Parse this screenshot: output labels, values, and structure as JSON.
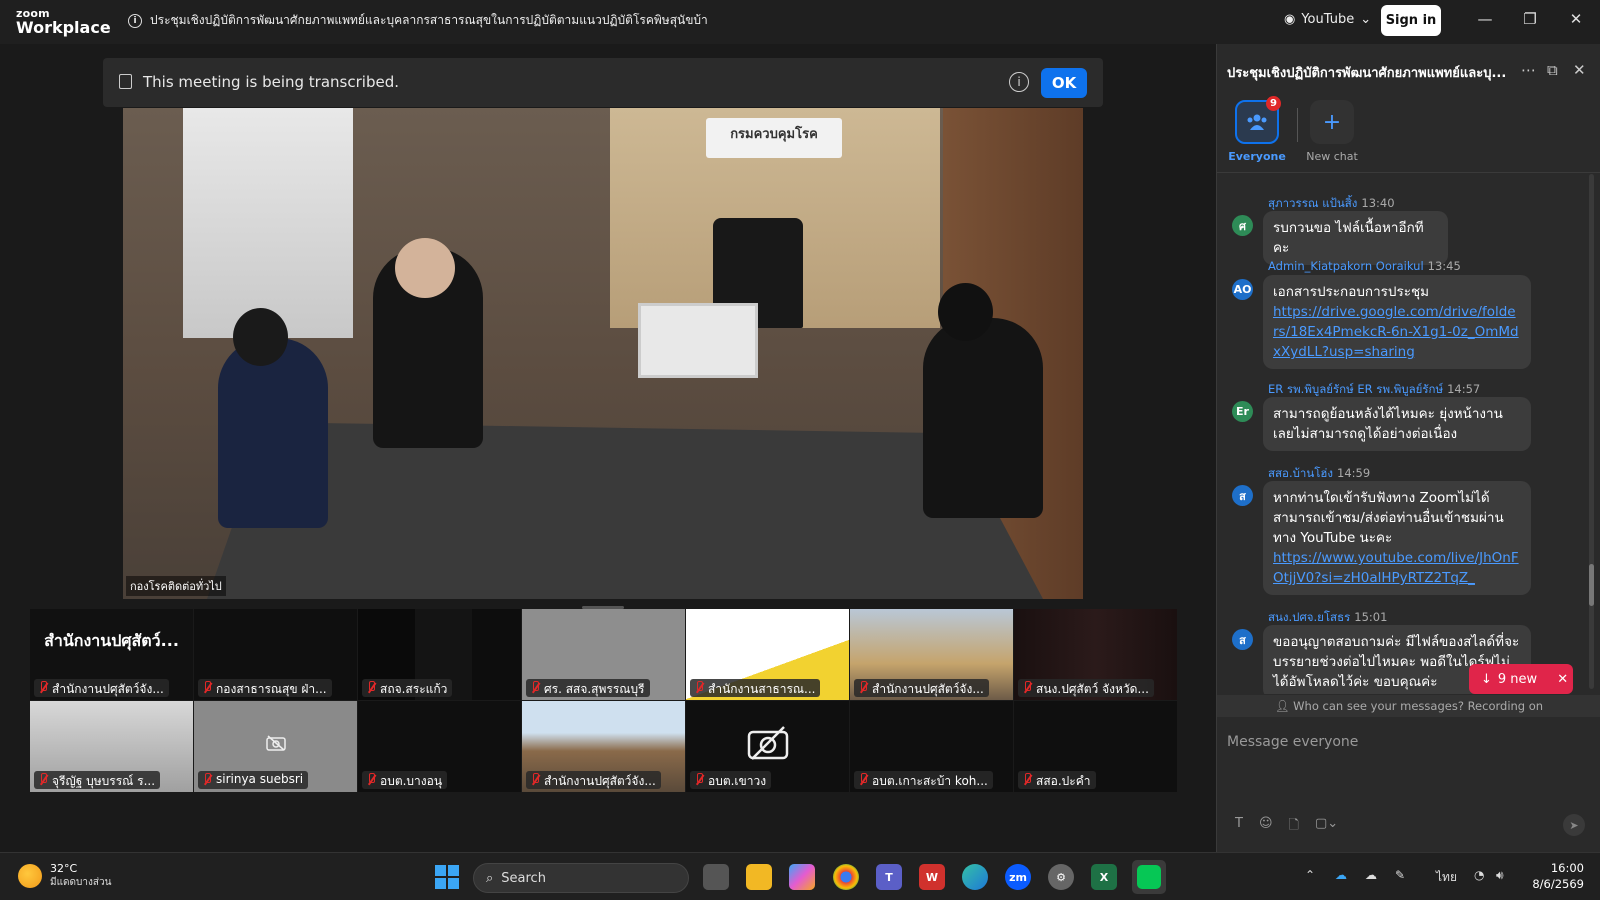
{
  "app": {
    "logo_top": "zoom",
    "logo_bottom": "Workplace",
    "meeting_title": "ประชุมเชิงปฏิบัติการพัฒนาศักยภาพแพทย์และบุคลากรสาธารณสุขในการปฏิบัติตามแนวปฏิบัติโรคพิษสุนัขบ้า"
  },
  "titlebar": {
    "youtube_label": "YouTube",
    "signin_label": "Sign in"
  },
  "banner": {
    "text": "This meeting is being transcribed.",
    "ok_label": "OK"
  },
  "main_video": {
    "sign_text": "กรมควบคุมโรค",
    "label": "กองโรคติดต่อทั่วไป"
  },
  "thumbnails": [
    {
      "name": "สำนักงานปศุสัตว์จัง...",
      "big": "สำนักงานปศุสัตว์..."
    },
    {
      "name": "กองสาธารณสุข ฝ่า..."
    },
    {
      "name": "สถจ.สระแก้ว"
    },
    {
      "name": "ศร. สสจ.สุพรรณบุรี"
    },
    {
      "name": "สำนักงานสาธารณ..."
    },
    {
      "name": "สำนักงานปศุสัตว์จัง..."
    },
    {
      "name": "สนง.ปศุสัตว์ จังหวัด..."
    },
    {
      "name": "จุรีญัฐ บุษบรรณ์ ร..."
    },
    {
      "name": "sirinya suebsri"
    },
    {
      "name": "อบต.บางอนุ"
    },
    {
      "name": "สำนักงานปศุสัตว์จัง..."
    },
    {
      "name": "อบต.เขาวง"
    },
    {
      "name": "อบต.เกาะสะบ้า koh..."
    },
    {
      "name": "สสอ.ปะคำ"
    }
  ],
  "chat": {
    "title": "ประชุมเชิงปฏิบัติการพัฒนาศักยภาพแพทย์และบุ...",
    "tabs": {
      "everyone": "Everyone",
      "new_chat": "New chat",
      "badge": "9"
    },
    "messages": [
      {
        "avatar": "ศ",
        "color": "#2e8b57",
        "sender": "สุภาวรรณ แป้นสิ้ง",
        "time": "13:40",
        "text": "รบกวนขอ ไฟล์เนื้อหาอีกทีคะ",
        "link": ""
      },
      {
        "avatar": "AO",
        "color": "#1e6fc9",
        "sender": "Admin_Kiatpakorn Ooraikul",
        "time": "13:45",
        "text": "เอกสารประกอบการประชุม",
        "link": "https://drive.google.com/drive/folders/18Ex4PmekcR-6n-X1g1-0z_OmMdxXydLL?usp=sharing"
      },
      {
        "avatar": "Er",
        "color": "#2e8b57",
        "sender": "ER รพ.พิบูลย์รักษ์ ER รพ.พิบูลย์รักษ์",
        "time": "14:57",
        "text": "สามารถดูย้อนหลังได้ไหมคะ ยุ่งหน้างาน เลยไม่สามารถดูได้อย่างต่อเนื่อง",
        "link": ""
      },
      {
        "avatar": "ส",
        "color": "#1e6fc9",
        "sender": "สสอ.บ้านโฮ่ง",
        "time": "14:59",
        "text": "หากท่านใดเข้ารับฟังทาง Zoomไม่ได้ สามารถเข้าชม/ส่งต่อท่านอื่นเข้าชมผ่านทาง YouTube นะคะ",
        "link": "https://www.youtube.com/live/JhOnFOtjjV0?si=zH0alHPyRTZ2TqZ_"
      },
      {
        "avatar": "ส",
        "color": "#1e6fc9",
        "sender": "สนง.ปศจ.ยโสธร",
        "time": "15:01",
        "text": "ขออนุญาตสอบถามค่ะ มีไฟล์ของสไลด์ที่จะบรรยายช่วงต่อไปไหมคะ พอดีในไดร์ฟไม่ได้อัพโหลดไว้ค่ะ ขอบคุณค่ะ",
        "link": ""
      }
    ],
    "new_messages": "9 new",
    "privacy": "Who can see your messages? Recording on",
    "compose_placeholder": "Message everyone"
  },
  "taskbar": {
    "weather_temp": "32°C",
    "weather_desc": "มีแดดบางส่วน",
    "search_label": "Search",
    "lang": "ไทย",
    "time": "16:00",
    "date": "8/6/2569"
  },
  "colors": {
    "accent": "#0e72ed",
    "alert": "#e0254a",
    "link": "#4a9aff"
  }
}
